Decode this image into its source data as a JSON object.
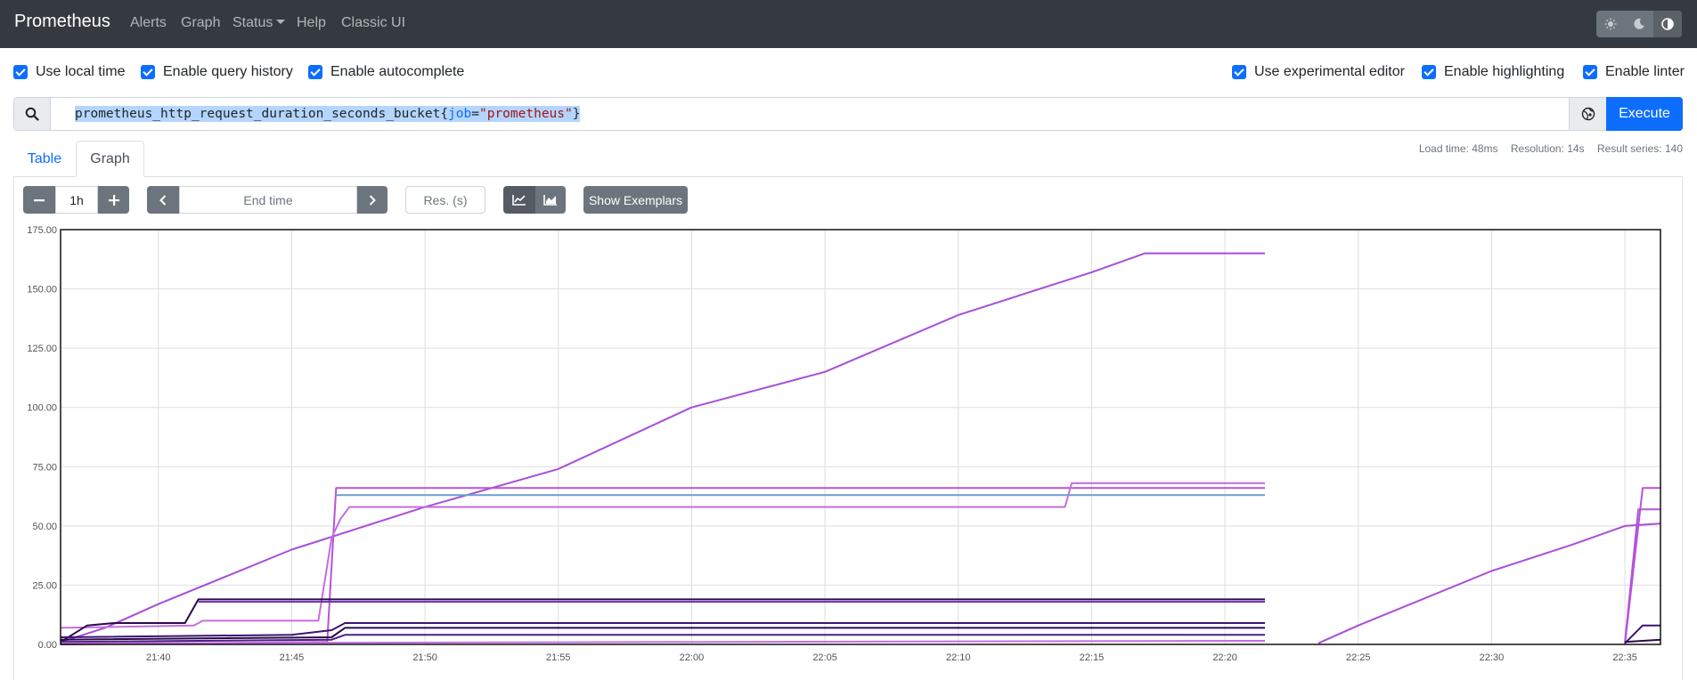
{
  "navbar": {
    "brand": "Prometheus",
    "links": [
      "Alerts",
      "Graph",
      "Status",
      "Help",
      "Classic UI"
    ],
    "theme_icons": [
      "sun-icon",
      "moon-icon",
      "contrast-icon"
    ]
  },
  "options": {
    "local_time": "Use local time",
    "query_history": "Enable query history",
    "autocomplete": "Enable autocomplete",
    "experimental_editor": "Use experimental editor",
    "highlighting": "Enable highlighting",
    "linter": "Enable linter"
  },
  "query": {
    "metric": "prometheus_http_request_duration_seconds_bucket",
    "label_name": "job",
    "label_value": "\"prometheus\"",
    "execute_label": "Execute"
  },
  "stats": {
    "load_time": "Load time: 48ms",
    "resolution": "Resolution: 14s",
    "result_series": "Result series: 140"
  },
  "tabs": [
    "Table",
    "Graph"
  ],
  "controls": {
    "range": "1h",
    "end_time_placeholder": "End time",
    "res_placeholder": "Res. (s)",
    "show_exemplars": "Show Exemplars"
  },
  "colors": {
    "navbar": "#343a40",
    "primary": "#0d6efd",
    "series_main": "#a84ed8",
    "series_light": "#c46ee0",
    "series_dark": "#2a0a4a",
    "series_mid": "#5b2a8f"
  },
  "chart_data": {
    "type": "line",
    "title": "",
    "xlabel": "",
    "ylabel": "",
    "ylim": [
      0,
      175
    ],
    "yticks": [
      "0.00",
      "25.00",
      "50.00",
      "75.00",
      "100.00",
      "125.00",
      "150.00",
      "175.00"
    ],
    "xticks": [
      "21:40",
      "21:45",
      "21:50",
      "21:55",
      "22:00",
      "22:05",
      "22:10",
      "22:15",
      "22:20",
      "22:25",
      "22:30",
      "22:35"
    ],
    "x_domain": [
      "21:36:20",
      "22:36:20"
    ],
    "grid": true,
    "series": [
      {
        "color": "#a84ed8",
        "points": [
          [
            "21:36:20",
            1
          ],
          [
            "21:38:00",
            7
          ],
          [
            "21:40:00",
            17
          ],
          [
            "21:45:00",
            40
          ],
          [
            "21:50:00",
            58
          ],
          [
            "21:55:00",
            74
          ],
          [
            "22:00:00",
            100
          ],
          [
            "22:05:00",
            115
          ],
          [
            "22:10:00",
            139
          ],
          [
            "22:15:00",
            157
          ],
          [
            "22:17:00",
            165
          ],
          [
            "22:21:30",
            165
          ]
        ]
      },
      {
        "color": "#a84ed8",
        "points": [
          [
            "22:23:30",
            0.5
          ],
          [
            "22:25:00",
            8
          ],
          [
            "22:30:00",
            31
          ],
          [
            "22:33:00",
            42
          ],
          [
            "22:35:00",
            50
          ],
          [
            "22:36:20",
            51
          ]
        ]
      },
      {
        "color": "#b554da",
        "points": [
          [
            "21:36:20",
            0
          ],
          [
            "21:46:20",
            1
          ],
          [
            "21:46:40",
            66
          ],
          [
            "22:21:30",
            66
          ]
        ]
      },
      {
        "color": "#b554da",
        "points": [
          [
            "22:35:00",
            0
          ],
          [
            "22:35:40",
            66
          ],
          [
            "22:36:20",
            66
          ]
        ]
      },
      {
        "color": "#6a9fd0",
        "points": [
          [
            "21:46:40",
            63
          ],
          [
            "22:21:30",
            63
          ]
        ]
      },
      {
        "color": "#c46ee0",
        "points": [
          [
            "21:36:20",
            7
          ],
          [
            "21:41:20",
            8
          ],
          [
            "21:41:40",
            10
          ],
          [
            "21:46:00",
            10
          ],
          [
            "21:46:30",
            45
          ],
          [
            "21:46:50",
            53
          ],
          [
            "21:47:10",
            58
          ],
          [
            "22:14:00",
            58
          ],
          [
            "22:14:15",
            68
          ],
          [
            "22:21:30",
            68
          ]
        ]
      },
      {
        "color": "#b554da",
        "points": [
          [
            "22:35:00",
            1
          ],
          [
            "22:35:30",
            57
          ],
          [
            "22:36:20",
            57
          ]
        ]
      },
      {
        "color": "#2a0a4a",
        "points": [
          [
            "21:36:20",
            1
          ],
          [
            "21:37:20",
            8
          ],
          [
            "21:38:20",
            9
          ],
          [
            "21:41:00",
            9
          ],
          [
            "21:41:30",
            19
          ],
          [
            "22:21:30",
            19
          ]
        ]
      },
      {
        "color": "#6b2ab0",
        "points": [
          [
            "21:41:30",
            18
          ],
          [
            "22:21:30",
            18
          ]
        ]
      },
      {
        "color": "#3d1470",
        "points": [
          [
            "21:36:20",
            3
          ],
          [
            "21:45:00",
            4
          ],
          [
            "21:46:30",
            6
          ],
          [
            "21:47:00",
            9
          ],
          [
            "22:21:30",
            9
          ]
        ]
      },
      {
        "color": "#2a0a4a",
        "points": [
          [
            "21:36:20",
            2
          ],
          [
            "21:46:30",
            3
          ],
          [
            "21:47:00",
            7
          ],
          [
            "22:21:30",
            7
          ]
        ]
      },
      {
        "color": "#4b1e80",
        "points": [
          [
            "21:36:20",
            1
          ],
          [
            "21:46:30",
            2
          ],
          [
            "21:47:00",
            4
          ],
          [
            "22:21:30",
            4
          ]
        ]
      },
      {
        "color": "#c46ee0",
        "points": [
          [
            "21:36:20",
            0.5
          ],
          [
            "22:21:30",
            1.5
          ]
        ]
      },
      {
        "color": "#3d1470",
        "points": [
          [
            "22:35:00",
            0.5
          ],
          [
            "22:35:40",
            8
          ],
          [
            "22:36:20",
            8
          ]
        ]
      },
      {
        "color": "#2a0a4a",
        "points": [
          [
            "22:35:00",
            1
          ],
          [
            "22:36:20",
            2
          ]
        ]
      }
    ]
  }
}
